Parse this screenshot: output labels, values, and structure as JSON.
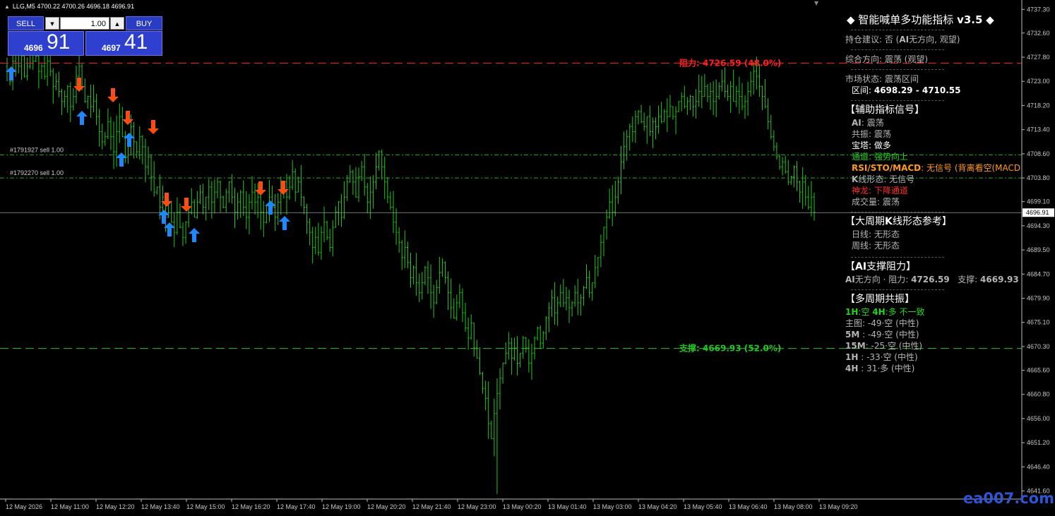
{
  "header": {
    "symbol_line": "LLG,M5  4700.22 4700.26 4696.18 4696.91"
  },
  "trade_panel": {
    "sell_label": "SELL",
    "buy_label": "BUY",
    "lot_value": "1.00",
    "sell_price_small": "4696",
    "sell_price_big": "91",
    "buy_price_small": "4697",
    "buy_price_big": "41"
  },
  "price_axis": {
    "ticks": [
      "4737.30",
      "4732.60",
      "4727.80",
      "4723.00",
      "4718.20",
      "4713.40",
      "4708.60",
      "4703.80",
      "4699.10",
      "4694.30",
      "4689.50",
      "4684.70",
      "4679.90",
      "4675.10",
      "4670.30",
      "4665.60",
      "4660.80",
      "4656.00",
      "4651.20",
      "4646.40",
      "4641.60"
    ],
    "current_price": "4696.91"
  },
  "time_axis": {
    "ticks": [
      "12 May 2026",
      "12 May 11:00",
      "12 May 12:20",
      "12 May 13:40",
      "12 May 15:00",
      "12 May 16:20",
      "12 May 17:40",
      "12 May 19:00",
      "12 May 20:20",
      "12 May 21:40",
      "12 May 23:00",
      "13 May 00:20",
      "13 May 01:40",
      "13 May 03:00",
      "13 May 04:20",
      "13 May 05:40",
      "13 May 06:40",
      "13 May 08:00",
      "13 May 09:20"
    ]
  },
  "lines": {
    "resistance_label": "阻力: 4726.59 (48.0%)",
    "support_label": "支撑: 4669.93 (52.0%)",
    "order1_label": "#1791927 sell 1.00",
    "order2_label": "#1792270 sell 1.00",
    "resistance_price": 4726.59,
    "support_price": 4669.93,
    "order1_price": 4708.4,
    "order2_price": 4703.8
  },
  "colors": {
    "bull_bar": "#22c81e",
    "bear_bar": "#22c81e",
    "resistance": "#ff2020",
    "support": "#22c81e",
    "up_arrow": "#1e88ff",
    "down_arrow": "#ff4c12",
    "order_line": "#22aa22",
    "watermark": "#2d55d6"
  },
  "chart_data": {
    "type": "ohlc",
    "symbol": "LLG",
    "timeframe": "M5",
    "ylim": [
      4640,
      4739
    ],
    "closes": [
      4725,
      4723,
      4727,
      4729,
      4726,
      4728,
      4724,
      4726,
      4730,
      4727,
      4728,
      4725,
      4726,
      4724,
      4727,
      4725,
      4722,
      4723,
      4721,
      4719,
      4720,
      4722,
      4718,
      4720,
      4724,
      4726,
      4722,
      4719,
      4720,
      4718,
      4719,
      4716,
      4713,
      4711,
      4712,
      4715,
      4712,
      4709,
      4713,
      4716,
      4712,
      4708,
      4711,
      4714,
      4711,
      4709,
      4712,
      4710,
      4706,
      4708,
      4704,
      4701,
      4702,
      4698,
      4700,
      4696,
      4699,
      4695,
      4693,
      4697,
      4694,
      4692,
      4695,
      4697,
      4699,
      4696,
      4699,
      4701,
      4698,
      4700,
      4702,
      4699,
      4701,
      4703,
      4700,
      4698,
      4701,
      4703,
      4700,
      4697,
      4699,
      4701,
      4698,
      4696,
      4699,
      4701,
      4699,
      4700,
      4697,
      4695,
      4697,
      4700,
      4698,
      4696,
      4699,
      4701,
      4703,
      4700,
      4702,
      4705,
      4701,
      4703,
      4700,
      4698,
      4695,
      4693,
      4690,
      4692,
      4689,
      4693,
      4695,
      4692,
      4690,
      4694,
      4697,
      4699,
      4696,
      4700,
      4703,
      4705,
      4703,
      4700,
      4704,
      4706,
      4702,
      4699,
      4701,
      4703,
      4706,
      4709,
      4706,
      4703,
      4700,
      4698,
      4695,
      4693,
      4691,
      4688,
      4690,
      4687,
      4684,
      4686,
      4683,
      4681,
      4683,
      4686,
      4684,
      4681,
      4679,
      4682,
      4685,
      4687,
      4684,
      4681,
      4678,
      4676,
      4679,
      4681,
      4677,
      4674,
      4672,
      4675,
      4670,
      4668,
      4665,
      4662,
      4660,
      4655,
      4652,
      4657,
      4661,
      4664,
      4667,
      4669,
      4671,
      4668,
      4670,
      4667,
      4669,
      4672,
      4670,
      4667,
      4669,
      4672,
      4674,
      4671,
      4673,
      4676,
      4678,
      4680,
      4677,
      4679,
      4681,
      4679,
      4680,
      4678,
      4679,
      4681,
      4679,
      4680,
      4682,
      4684,
      4681,
      4683,
      4686,
      4688,
      4691,
      4694,
      4696,
      4699,
      4697,
      4700,
      4703,
      4707,
      4710,
      4712,
      4714,
      4713,
      4716,
      4717,
      4715,
      4714,
      4716,
      4713,
      4715,
      4714,
      4716,
      4715,
      4717,
      4716,
      4718,
      4716,
      4717,
      4719,
      4720,
      4718,
      4719,
      4720,
      4718,
      4719,
      4721,
      4720,
      4722,
      4720,
      4721,
      4719,
      4720,
      4722,
      4723,
      4721,
      4720,
      4722,
      4719,
      4721,
      4720,
      4718,
      4719,
      4721,
      4723,
      4725,
      4724,
      4722,
      4720,
      4718,
      4715,
      4712,
      4710,
      4708,
      4706,
      4707,
      4705,
      4703,
      4704,
      4706,
      4703,
      4701,
      4703,
      4700,
      4698,
      4700,
      4697
    ]
  }
}
